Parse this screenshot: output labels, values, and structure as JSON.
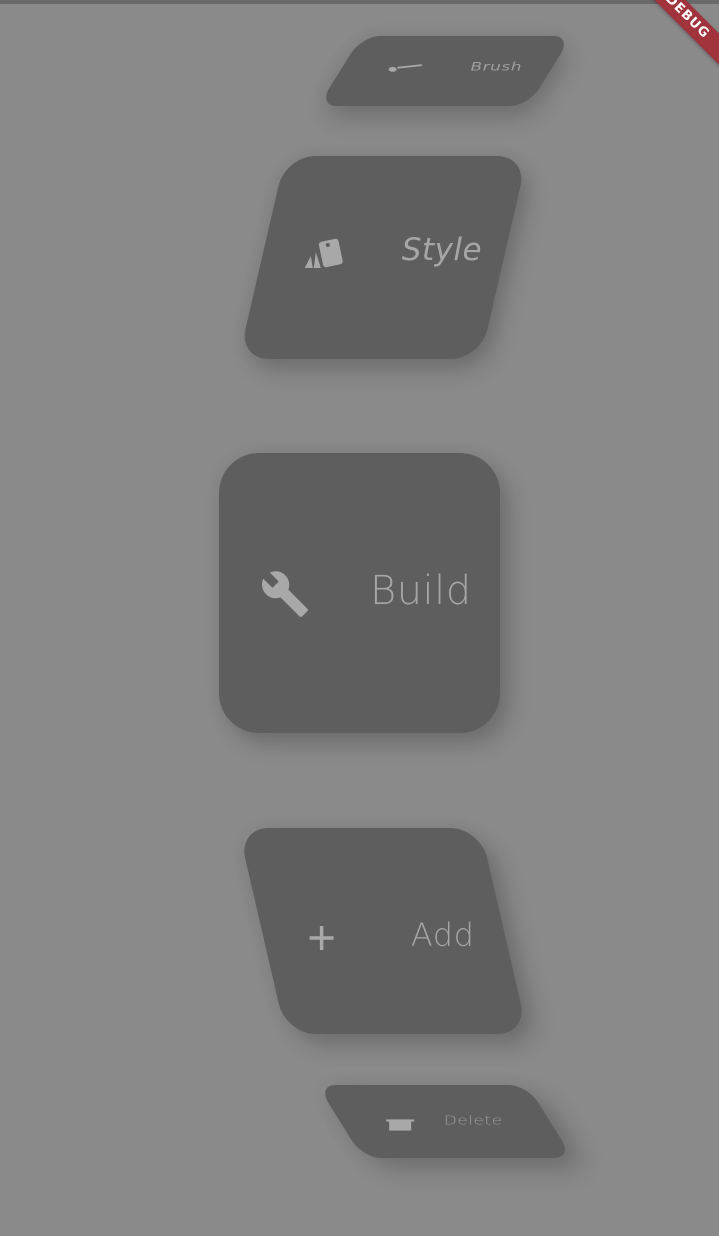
{
  "menu": {
    "items": [
      {
        "label": "Brush",
        "icon": "brush-icon"
      },
      {
        "label": "Style",
        "icon": "style-icon"
      },
      {
        "label": "Build",
        "icon": "wrench-icon"
      },
      {
        "label": "Add",
        "icon": "plus-icon"
      },
      {
        "label": "Delete",
        "icon": "trash-icon"
      }
    ],
    "selected": "Build"
  },
  "debug_banner": {
    "text": "DEBUG",
    "color": "#a0333b"
  },
  "colors": {
    "background": "#8a8a8a",
    "card": "#5e5e5e",
    "text": "#a6a6a6"
  }
}
